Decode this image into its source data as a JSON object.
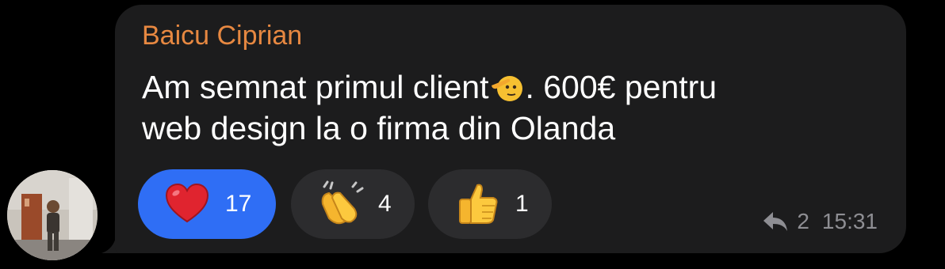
{
  "message": {
    "sender": "Baicu Ciprian",
    "text_line1_before_emoji": "Am semnat primul client",
    "text_line1_after_emoji": ". 600€ pentru",
    "text_line2": "web design la o firma din Olanda",
    "inline_emoji": "saluting-face"
  },
  "reactions": [
    {
      "emoji": "red-heart",
      "count": "17",
      "active": true
    },
    {
      "emoji": "clapping-hands",
      "count": "4",
      "active": false
    },
    {
      "emoji": "thumbs-up",
      "count": "1",
      "active": false
    }
  ],
  "meta": {
    "reply_icon": "reply-arrow-icon",
    "reply_count": "2",
    "time": "15:31"
  },
  "colors": {
    "background": "#000000",
    "bubble": "#1c1c1d",
    "sender_name": "#e78841",
    "active_reaction": "#2f6ef5",
    "reaction": "#2c2c2e",
    "meta_text": "#8e8e93"
  }
}
